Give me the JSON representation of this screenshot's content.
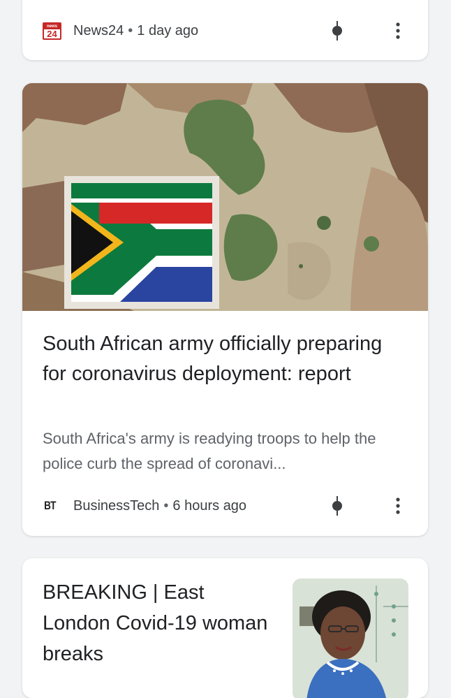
{
  "cards": [
    {
      "source": "News24",
      "logo_text": "news",
      "logo_num": "24",
      "separator": "•",
      "time": "1 day ago"
    },
    {
      "source": "BusinessTech",
      "logo_text": "BT",
      "separator": "•",
      "time": "6 hours ago",
      "headline": "South African army officially preparing for coronavirus deployment: report",
      "snippet": "South Africa's army is readying troops to help the police curb the spread of coronavi..."
    },
    {
      "headline": "BREAKING | East London Covid-19 woman breaks"
    }
  ],
  "icons": {
    "pin": "pin-icon",
    "more": "more-vert-icon"
  },
  "colors": {
    "background": "#f1f3f4",
    "card": "#ffffff",
    "headline": "#202124",
    "meta": "#5f6368"
  }
}
